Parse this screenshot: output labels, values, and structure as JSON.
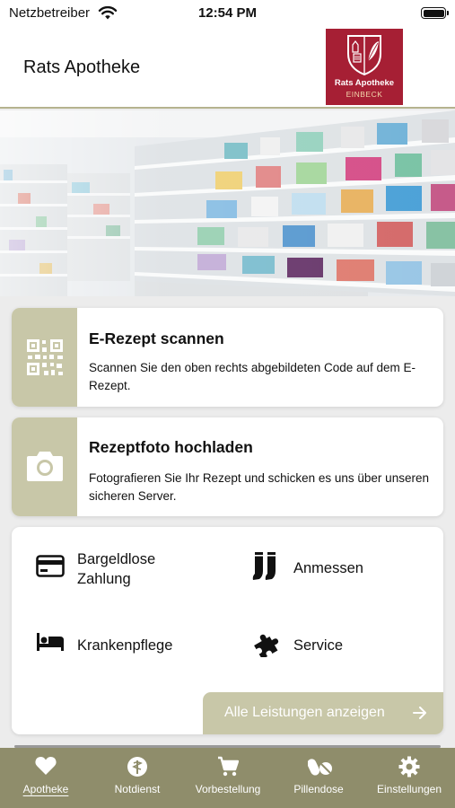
{
  "status_bar": {
    "carrier": "Netzbetreiber",
    "time": "12:54 PM",
    "icons": [
      "wifi-icon",
      "battery-icon"
    ]
  },
  "header": {
    "title": "Rats Apotheke",
    "logo": {
      "name": "Rats Apotheke",
      "city": "EINBECK",
      "color": "#a61f34"
    }
  },
  "hero": {
    "image": "pharmacy-shelves-photo"
  },
  "actions": [
    {
      "icon": "qr-code-icon",
      "title": "E-Rezept scannen",
      "description": "Scannen Sie den oben rechts abgebildeten Code auf dem E-Rezept."
    },
    {
      "icon": "camera-icon",
      "title": "Rezeptfoto hochladen",
      "description": "Fotografieren Sie Ihr Rezept und schicken es uns über unseren sicheren Server."
    }
  ],
  "services": {
    "items": [
      {
        "icon": "credit-card-icon",
        "label": "Bargeldlose Zahlung"
      },
      {
        "icon": "stockings-icon",
        "label": "Anmessen"
      },
      {
        "icon": "bed-icon",
        "label": "Krankenpflege"
      },
      {
        "icon": "puzzle-icon",
        "label": "Service"
      }
    ],
    "all_button": "Alle Leistungen anzeigen"
  },
  "tab_bar": {
    "tabs": [
      {
        "icon": "heart-icon",
        "label": "Apotheke",
        "active": true
      },
      {
        "icon": "emergency-icon",
        "label": "Notdienst",
        "active": false
      },
      {
        "icon": "cart-icon",
        "label": "Vorbestellung",
        "active": false
      },
      {
        "icon": "pills-icon",
        "label": "Pillendose",
        "active": false
      },
      {
        "icon": "gear-icon",
        "label": "Einstellungen",
        "active": false
      }
    ]
  },
  "colors": {
    "accent": "#c8c7a8",
    "tab_bar": "#8f8d6b",
    "brand_red": "#a61f34",
    "background": "#ececec"
  }
}
